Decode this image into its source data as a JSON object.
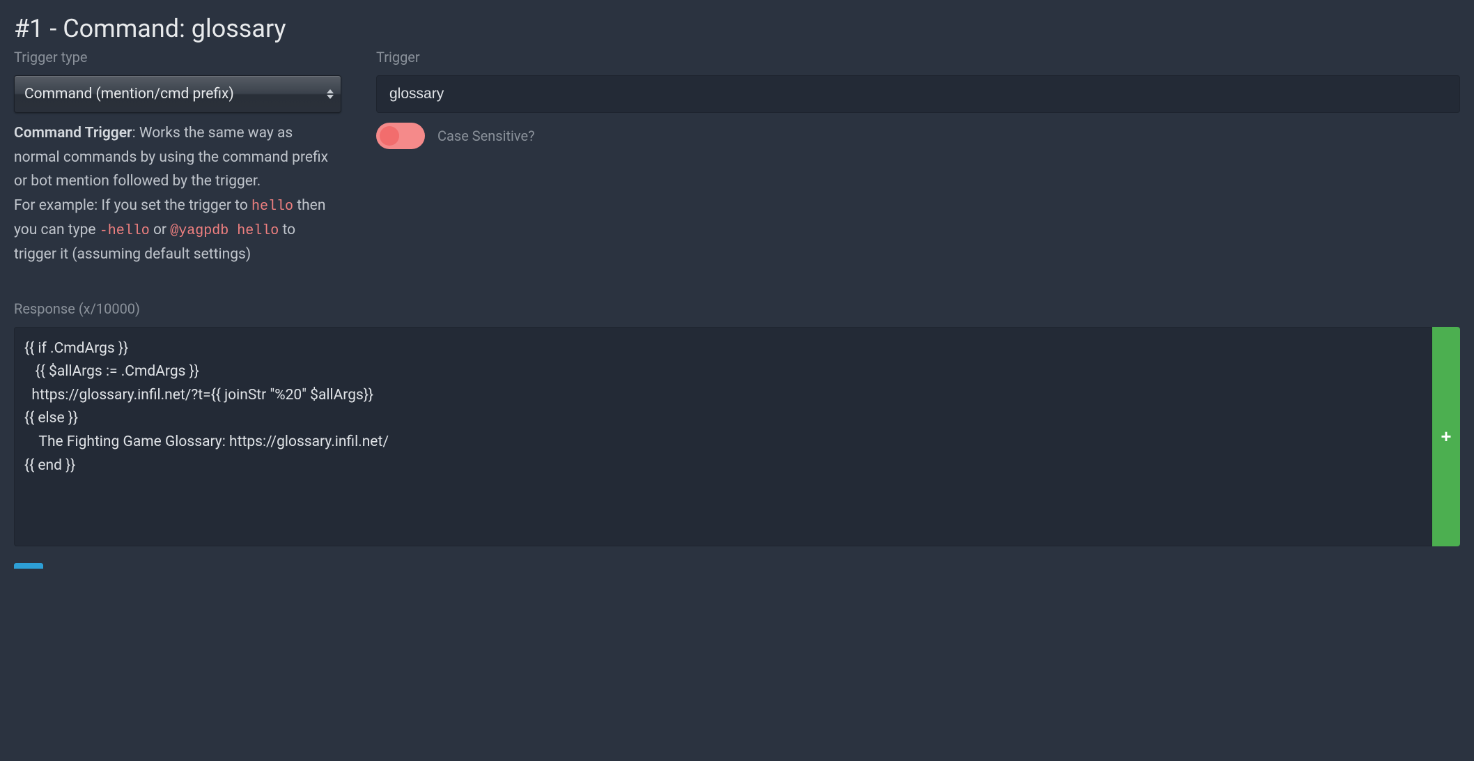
{
  "header": {
    "title": "#1 - Command: glossary"
  },
  "triggerType": {
    "label": "Trigger type",
    "selected": "Command (mention/cmd prefix)",
    "help": {
      "intro_strong": "Command Trigger",
      "intro_rest": ": Works the same way as normal commands by using the command prefix or bot mention followed by the trigger.",
      "example_prefix": "For example: If you set the trigger to ",
      "code1": "hello",
      "example_mid1": " then you can type ",
      "code2": "-hello",
      "example_mid2": " or ",
      "code3": "@yagpdb hello",
      "example_suffix": " to trigger it (assuming default settings)"
    }
  },
  "trigger": {
    "label": "Trigger",
    "value": "glossary",
    "caseSensitiveLabel": "Case Sensitive?",
    "caseSensitive": false
  },
  "response": {
    "label": "Response (x/10000)",
    "body": "{{ if .CmdArgs }}\n   {{ $allArgs := .CmdArgs }}\n  https://glossary.infil.net/?t={{ joinStr \"%20\" $allArgs}}\n{{ else }}\n    The Fighting Game Glossary: https://glossary.infil.net/\n{{ end }}",
    "addButtonLabel": "+"
  }
}
